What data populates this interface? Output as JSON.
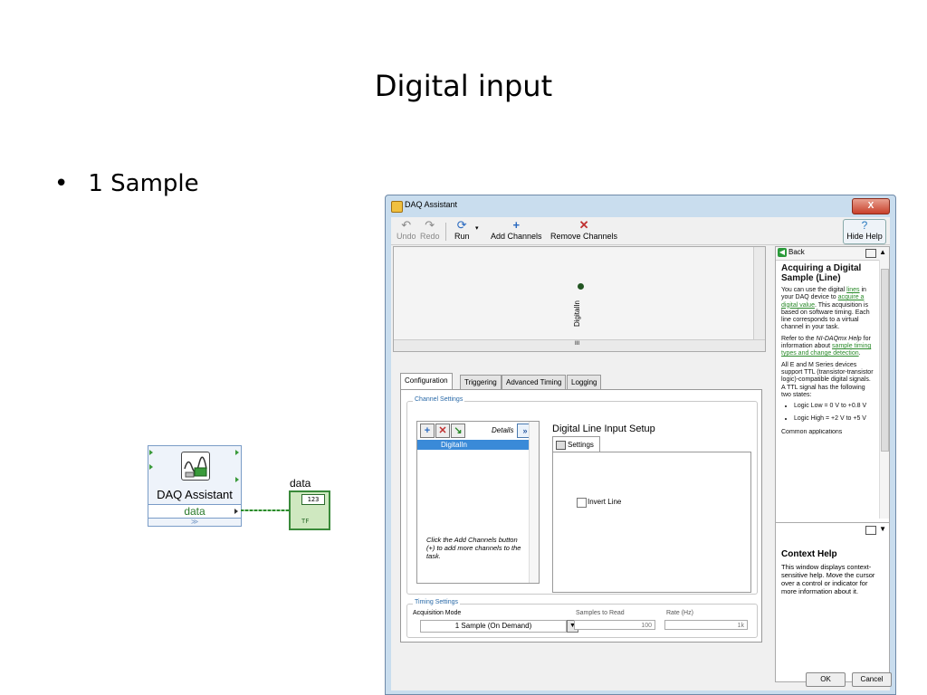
{
  "slide": {
    "title": "Digital input",
    "bullet": "1 Sample",
    "bullet_marker": "•"
  },
  "diagram": {
    "vi_title": "DAQ Assistant",
    "output_terminal": "data",
    "indicator_label": "data",
    "indicator_numeric": "123",
    "indicator_bool": "TF",
    "expander_glyph": "≫"
  },
  "window": {
    "title": "DAQ Assistant",
    "close_glyph": "X",
    "toolbar": {
      "undo": "Undo",
      "redo": "Redo",
      "run": "Run",
      "add_channels": "Add Channels",
      "remove_channels": "Remove Channels",
      "hide_help": "Hide Help"
    },
    "preview_channel": "DigitalIn",
    "preview_scroll_glyph": "III",
    "tabs": [
      "Configuration",
      "Triggering",
      "Advanced Timing",
      "Logging"
    ],
    "channel_settings": {
      "group_label": "Channel Settings",
      "details": "Details",
      "details_glyph": "»",
      "channels": [
        "DigitalIn"
      ],
      "hint": "Click the Add Channels button (+) to add more channels to the task."
    },
    "setup": {
      "title": "Digital Line Input Setup",
      "settings_tab": "Settings",
      "invert_line": "Invert Line",
      "invert_checked": false
    },
    "timing": {
      "group_label": "Timing Settings",
      "acquisition_mode_label": "Acquisition Mode",
      "acquisition_mode_value": "1 Sample (On Demand)",
      "samples_label": "Samples to Read",
      "samples_value": "100",
      "rate_label": "Rate (Hz)",
      "rate_value": "1k"
    },
    "help": {
      "back": "Back",
      "title": "Acquiring a Digital Sample (Line)",
      "p1_a": "You can use the digital ",
      "p1_link1": "lines",
      "p1_b": " in your DAQ device to ",
      "p1_link2": "acquire a digital value",
      "p1_c": ". This acquisition is based on software timing. Each line corresponds to a virtual channel in your task.",
      "p2_a": "Refer to the ",
      "p2_em": "NI-DAQmx Help",
      "p2_b": " for information about ",
      "p2_link": "sample timing types and change detection",
      "p2_c": ".",
      "p3": "All E and M Series devices support TTL (transistor-transistor logic)-compatible digital signals. A TTL signal has the following two states:",
      "li1": "Logic Low = 0 V to +0.8 V",
      "li2": "Logic High = +2 V to +5 V",
      "p4": "Common applications",
      "ctx_title": "Context Help",
      "ctx_body": "This window displays context-sensitive help. Move the cursor over a control or indicator for more information about it."
    },
    "ok": "OK",
    "cancel": "Cancel"
  }
}
